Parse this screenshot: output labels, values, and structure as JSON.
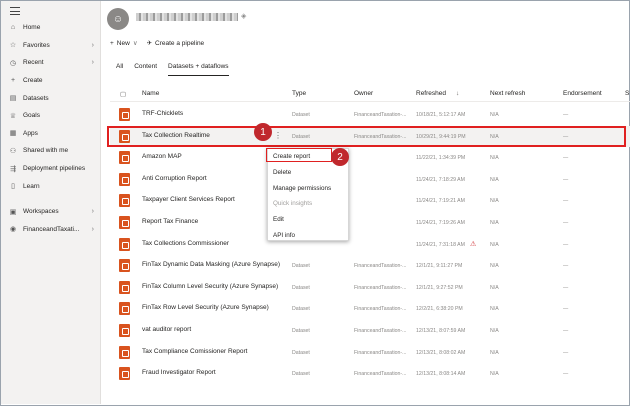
{
  "sidebar": {
    "items": [
      {
        "label": "Home",
        "icon": "home-icon",
        "glyph": "⌂",
        "chevron": false
      },
      {
        "label": "Favorites",
        "icon": "star-icon",
        "glyph": "☆",
        "chevron": true
      },
      {
        "label": "Recent",
        "icon": "clock-icon",
        "glyph": "◷",
        "chevron": true
      },
      {
        "label": "Create",
        "icon": "plus-icon",
        "glyph": "+",
        "chevron": false
      },
      {
        "label": "Datasets",
        "icon": "database-icon",
        "glyph": "▤",
        "chevron": false
      },
      {
        "label": "Goals",
        "icon": "trophy-icon",
        "glyph": "♕",
        "chevron": false
      },
      {
        "label": "Apps",
        "icon": "apps-icon",
        "glyph": "▦",
        "chevron": false
      },
      {
        "label": "Shared with me",
        "icon": "shared-icon",
        "glyph": "⚇",
        "chevron": false
      },
      {
        "label": "Deployment pipelines",
        "icon": "pipeline-icon",
        "glyph": "⇶",
        "chevron": false
      },
      {
        "label": "Learn",
        "icon": "book-icon",
        "glyph": "▯",
        "chevron": false
      }
    ],
    "bottom": [
      {
        "label": "Workspaces",
        "icon": "workspaces-icon",
        "glyph": "▣",
        "chevron": true
      },
      {
        "label": "FinanceandTaxati...",
        "icon": "workspace-avatar-icon",
        "glyph": "◉",
        "chevron": true
      }
    ]
  },
  "toolbar": {
    "new_label": "New",
    "new_chevron": "∨",
    "create_pipeline_label": "Create a pipeline"
  },
  "tabs": [
    "All",
    "Content",
    "Datasets + dataflows"
  ],
  "columns": [
    "Name",
    "Type",
    "Owner",
    "Refreshed",
    "Next refresh",
    "Endorsement",
    "S"
  ],
  "rows": [
    {
      "name": "TRF-Chicklets",
      "type": "Dataset",
      "owner": "FinanceandTaxation-...",
      "refreshed": "10/18/21, 5:12:17 AM",
      "next": "N/A",
      "endorsement": "—",
      "warn": false
    },
    {
      "name": "Tax Collection Realtime",
      "type": "Dataset",
      "owner": "FinanceandTaxation-...",
      "refreshed": "10/29/21, 9:44:19 PM",
      "next": "N/A",
      "endorsement": "—",
      "warn": false
    },
    {
      "name": "Amazon MAP",
      "type": "",
      "owner": "",
      "refreshed": "11/22/21, 1:34:39 PM",
      "next": "N/A",
      "endorsement": "—",
      "warn": false
    },
    {
      "name": "Anti Corruption Report",
      "type": "",
      "owner": "",
      "refreshed": "11/24/21, 7:18:29 AM",
      "next": "N/A",
      "endorsement": "—",
      "warn": false
    },
    {
      "name": "Taxpayer Client Services Report",
      "type": "",
      "owner": "",
      "refreshed": "11/24/21, 7:19:21 AM",
      "next": "N/A",
      "endorsement": "—",
      "warn": false
    },
    {
      "name": "Report Tax Finance",
      "type": "",
      "owner": "",
      "refreshed": "11/24/21, 7:19:26 AM",
      "next": "N/A",
      "endorsement": "—",
      "warn": false
    },
    {
      "name": "Tax Collections Commissioner",
      "type": "",
      "owner": "",
      "refreshed": "11/24/21, 7:31:18 AM",
      "next": "N/A",
      "endorsement": "—",
      "warn": true
    },
    {
      "name": "FinTax Dynamic Data Masking (Azure Synapse)",
      "type": "Dataset",
      "owner": "FinanceandTaxation-...",
      "refreshed": "12/1/21, 9:11:27 PM",
      "next": "N/A",
      "endorsement": "—",
      "warn": false
    },
    {
      "name": "FinTax Column Level Security (Azure Synapse)",
      "type": "Dataset",
      "owner": "FinanceandTaxation-...",
      "refreshed": "12/1/21, 9:27:52 PM",
      "next": "N/A",
      "endorsement": "—",
      "warn": false
    },
    {
      "name": "FinTax Row Level Security (Azure Synapse)",
      "type": "Dataset",
      "owner": "FinanceandTaxation-...",
      "refreshed": "12/2/21, 6:38:20 PM",
      "next": "N/A",
      "endorsement": "—",
      "warn": false
    },
    {
      "name": "vat auditor report",
      "type": "Dataset",
      "owner": "FinanceandTaxation-...",
      "refreshed": "12/13/21, 8:07:59 AM",
      "next": "N/A",
      "endorsement": "—",
      "warn": false
    },
    {
      "name": "Tax Compliance Comissioner Report",
      "type": "Dataset",
      "owner": "FinanceandTaxation-...",
      "refreshed": "12/13/21, 8:08:02 AM",
      "next": "N/A",
      "endorsement": "—",
      "warn": false
    },
    {
      "name": "Fraud Investigator Report",
      "type": "Dataset",
      "owner": "FinanceandTaxation-...",
      "refreshed": "12/13/21, 8:08:14 AM",
      "next": "N/A",
      "endorsement": "—",
      "warn": false
    }
  ],
  "context_menu": {
    "items": [
      {
        "label": "Create report",
        "disabled": false
      },
      {
        "label": "Delete",
        "disabled": false
      },
      {
        "label": "Manage permissions",
        "disabled": false
      },
      {
        "label": "Quick insights",
        "disabled": true
      },
      {
        "label": "Edit",
        "disabled": false
      },
      {
        "label": "API info",
        "disabled": false
      }
    ]
  },
  "callouts": [
    "1",
    "2"
  ],
  "colors": {
    "highlight": "#e02020",
    "callout": "#c0282d",
    "dataset_icon": "#d9531e"
  }
}
